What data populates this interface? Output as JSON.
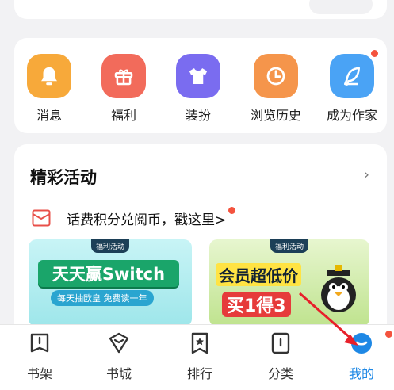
{
  "shortcuts": [
    {
      "label": "消息",
      "icon": "bell-icon",
      "color": "#f7a93a"
    },
    {
      "label": "福利",
      "icon": "gift-icon",
      "color": "#f26b5b"
    },
    {
      "label": "装扮",
      "icon": "tshirt-icon",
      "color": "#7a6cf0"
    },
    {
      "label": "浏览历史",
      "icon": "clock-icon",
      "color": "#f5954b"
    },
    {
      "label": "成为作家",
      "icon": "feather-pen-icon",
      "color": "#4aa3f5",
      "has_badge": true
    }
  ],
  "activities": {
    "title": "精彩活动",
    "promo_text": "话费积分兑阅币，戳这里>",
    "banners": [
      {
        "tag": "福利活动",
        "headline": "天天赢Switch",
        "sub": "每天抽欧皇 免费读一年"
      },
      {
        "tag": "福利活动",
        "headline_1": "会员超低价",
        "headline_2": "买1得3"
      }
    ]
  },
  "tabbar": {
    "tabs": [
      {
        "label": "书架",
        "icon": "bookshelf-icon"
      },
      {
        "label": "书城",
        "icon": "bookstore-icon"
      },
      {
        "label": "排行",
        "icon": "ranking-bookmark-icon"
      },
      {
        "label": "分类",
        "icon": "category-icon"
      },
      {
        "label": "我的",
        "icon": "profile-icon",
        "active": true
      }
    ]
  },
  "colors": {
    "accent": "#1e88e5",
    "badge": "#f4533e"
  }
}
